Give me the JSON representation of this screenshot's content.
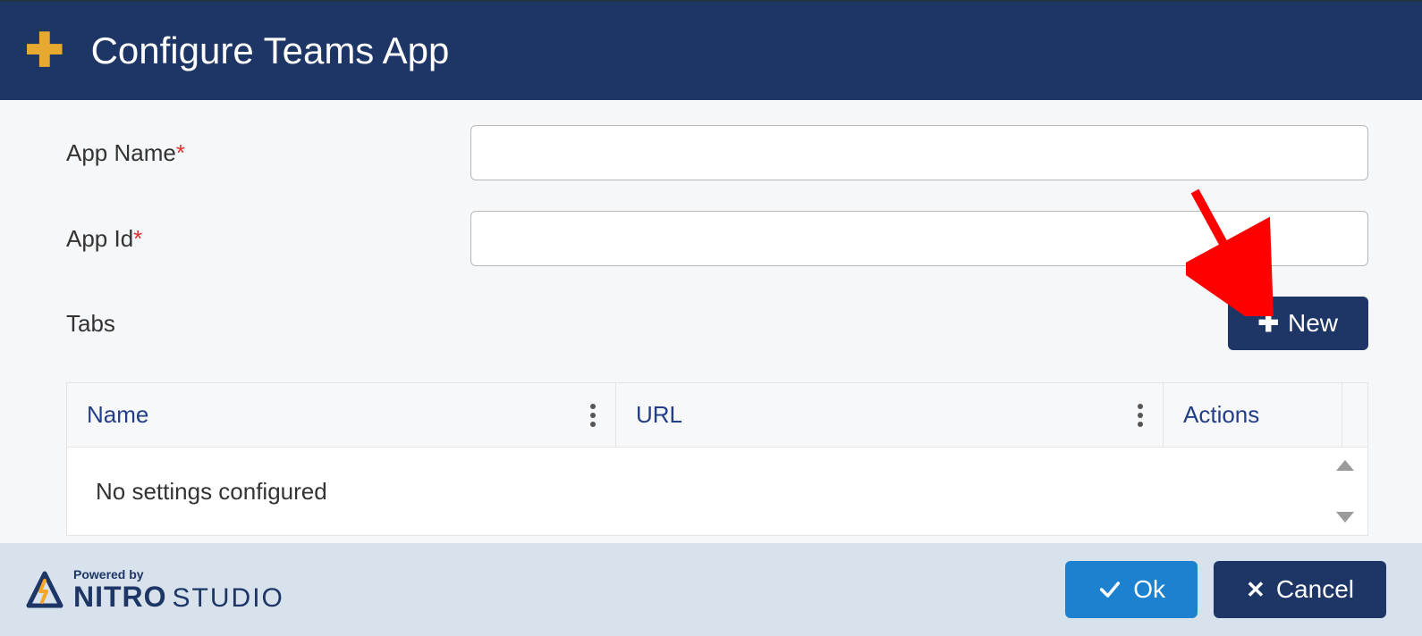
{
  "header": {
    "title": "Configure Teams App"
  },
  "form": {
    "appName": {
      "label": "App Name",
      "value": ""
    },
    "appId": {
      "label": "App Id",
      "value": ""
    },
    "tabsLabel": "Tabs",
    "newButton": "New"
  },
  "table": {
    "columns": {
      "name": "Name",
      "url": "URL",
      "actions": "Actions"
    },
    "emptyMessage": "No settings configured"
  },
  "footer": {
    "poweredBy": "Powered by",
    "brandA": "NITRO",
    "brandB": "STUDIO",
    "ok": "Ok",
    "cancel": "Cancel"
  }
}
